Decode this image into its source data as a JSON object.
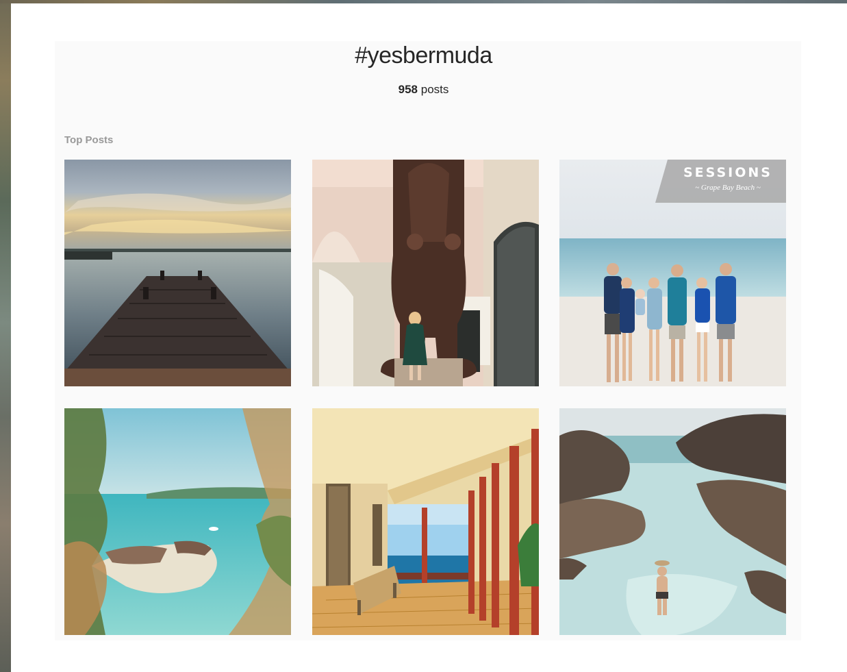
{
  "hashtag": {
    "title": "#yesbermuda",
    "post_count_number": "958",
    "post_count_word": "posts"
  },
  "sections": {
    "top_posts_label": "Top Posts"
  },
  "posts": [
    {
      "subject": "wooden dock at sunset over calm water"
    },
    {
      "subject": "large bronze cartoon statue with woman in green dress"
    },
    {
      "subject": "family portrait on the beach",
      "overlay_title": "SESSIONS",
      "overlay_subtitle": "~ Grape Bay Beach ~"
    },
    {
      "subject": "turquoise cove framed by pine branches"
    },
    {
      "subject": "sunlit veranda with red columns overlooking the sea"
    },
    {
      "subject": "woman in hat wading in a rocky tide pool"
    }
  ],
  "colors": {
    "panel_background": "#fafafa",
    "title_text": "#262626",
    "label_text": "#999999"
  }
}
